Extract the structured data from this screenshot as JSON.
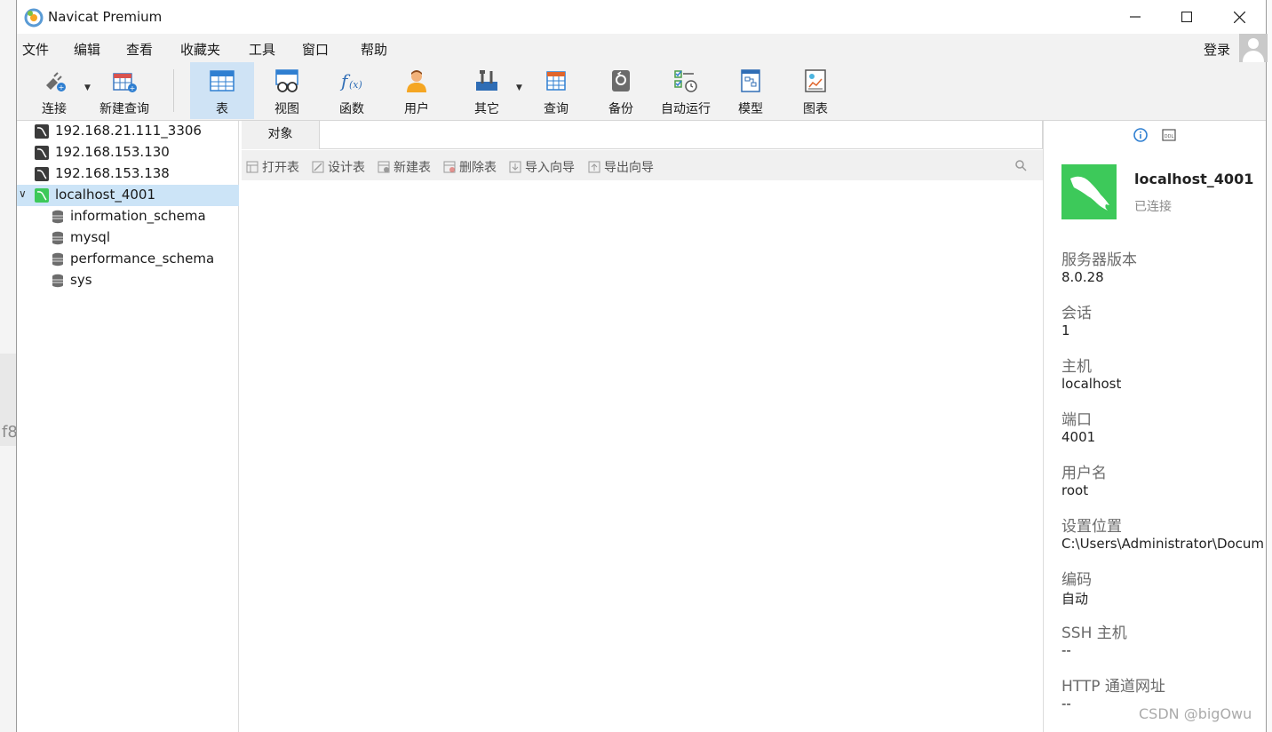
{
  "window": {
    "title": "Navicat Premium",
    "minimize": "—",
    "maximize": "☐",
    "close": "✕"
  },
  "menu": {
    "items": [
      "文件",
      "编辑",
      "查看",
      "收藏夹",
      "工具",
      "窗口",
      "帮助"
    ],
    "login": "登录"
  },
  "toolbar": {
    "buttons": [
      {
        "label": "连接",
        "icon": "plug-icon"
      },
      {
        "label": "新建查询",
        "icon": "new-query-icon"
      },
      {
        "label": "表",
        "icon": "table-icon"
      },
      {
        "label": "视图",
        "icon": "view-icon"
      },
      {
        "label": "函数",
        "icon": "function-icon"
      },
      {
        "label": "用户",
        "icon": "user-icon"
      },
      {
        "label": "其它",
        "icon": "tools-icon"
      },
      {
        "label": "查询",
        "icon": "query-icon"
      },
      {
        "label": "备份",
        "icon": "backup-icon"
      },
      {
        "label": "自动运行",
        "icon": "schedule-icon"
      },
      {
        "label": "模型",
        "icon": "model-icon"
      },
      {
        "label": "图表",
        "icon": "chart-icon"
      }
    ],
    "active": "表"
  },
  "tree": {
    "connections": [
      {
        "label": "192.168.21.111_3306",
        "state": "closed"
      },
      {
        "label": "192.168.153.130",
        "state": "closed"
      },
      {
        "label": "192.168.153.138",
        "state": "closed"
      },
      {
        "label": "localhost_4001",
        "state": "open"
      }
    ],
    "databases": [
      "information_schema",
      "mysql",
      "performance_schema",
      "sys"
    ],
    "expanded_caret": "∨"
  },
  "objects": {
    "tab": "对象",
    "actions": [
      "打开表",
      "设计表",
      "新建表",
      "删除表",
      "导入向导",
      "导出向导"
    ]
  },
  "info": {
    "name": "localhost_4001",
    "status": "已连接",
    "properties": [
      {
        "label": "服务器版本",
        "value": "8.0.28"
      },
      {
        "label": "会话",
        "value": "1"
      },
      {
        "label": "主机",
        "value": "localhost"
      },
      {
        "label": "端口",
        "value": "4001"
      },
      {
        "label": "用户名",
        "value": "root"
      },
      {
        "label": "设置位置",
        "value": "C:\\Users\\Administrator\\Docum"
      },
      {
        "label": "编码",
        "value": "自动"
      },
      {
        "label": "SSH 主机",
        "value": "--"
      },
      {
        "label": "HTTP 通道网址",
        "value": "--"
      }
    ]
  },
  "watermark": "CSDN @bigOwu",
  "background": {
    "edge_text": "f8"
  },
  "colors": {
    "selected": "#cce4f7",
    "active_tool": "#cfe3f5",
    "mysql_green": "#3dc95a"
  }
}
